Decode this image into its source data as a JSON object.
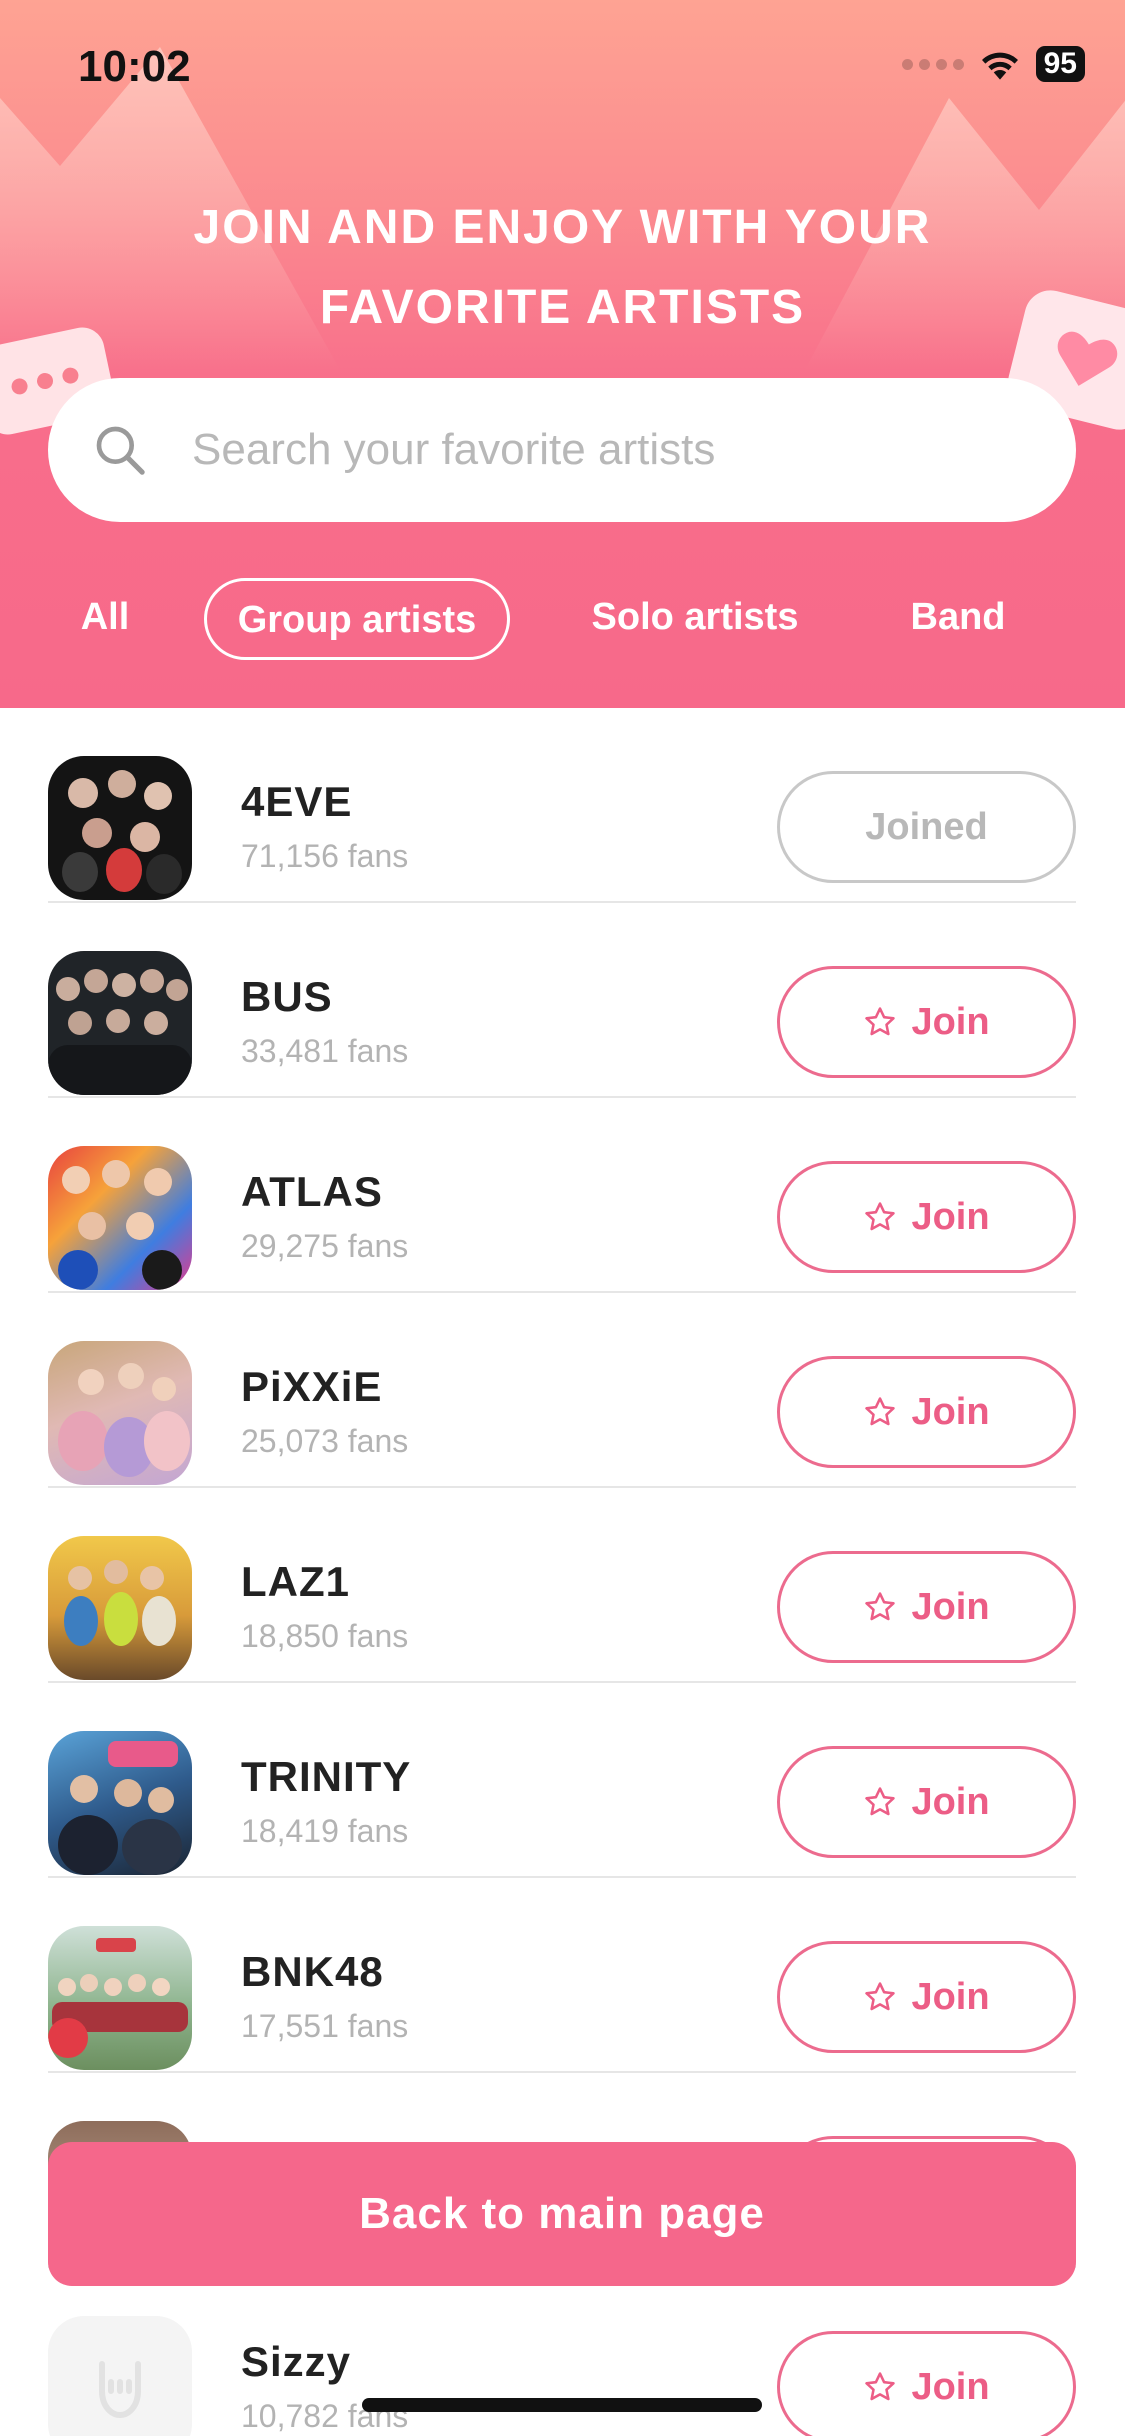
{
  "status_bar": {
    "time": "10:02",
    "battery": "95"
  },
  "header": {
    "headline_line1": "JOIN AND ENJOY WITH YOUR",
    "headline_line2": "FAVORITE ARTISTS"
  },
  "search": {
    "placeholder": "Search your favorite artists",
    "value": ""
  },
  "filters": {
    "tabs": [
      {
        "label": "All",
        "selected": false
      },
      {
        "label": "Group artists",
        "selected": true
      },
      {
        "label": "Solo artists",
        "selected": false
      },
      {
        "label": "Band",
        "selected": false
      }
    ]
  },
  "artists": [
    {
      "name": "4EVE",
      "fans": "71,156 fans",
      "button": "Joined",
      "joined": true
    },
    {
      "name": "BUS",
      "fans": "33,481 fans",
      "button": "Join",
      "joined": false
    },
    {
      "name": "ATLAS",
      "fans": "29,275 fans",
      "button": "Join",
      "joined": false
    },
    {
      "name": "PiXXiE",
      "fans": "25,073 fans",
      "button": "Join",
      "joined": false
    },
    {
      "name": "LAZ1",
      "fans": "18,850 fans",
      "button": "Join",
      "joined": false
    },
    {
      "name": "TRINITY",
      "fans": "18,419 fans",
      "button": "Join",
      "joined": false
    },
    {
      "name": "BNK48",
      "fans": "17,551 fans",
      "button": "Join",
      "joined": false
    },
    {
      "name": "",
      "fans": "",
      "button": "",
      "joined": false
    },
    {
      "name": "Sizzy",
      "fans": "10,782 fans",
      "button": "Join",
      "joined": false
    }
  ],
  "footer": {
    "back_label": "Back to main page"
  },
  "colors": {
    "accent": "#f5678b",
    "header_top": "#fea393",
    "header_bottom": "#f7698a",
    "muted": "#b3b3b3"
  },
  "icons": {
    "search": "search-icon",
    "star": "star-outline-icon",
    "wifi": "wifi-icon",
    "heart": "heart-icon"
  }
}
